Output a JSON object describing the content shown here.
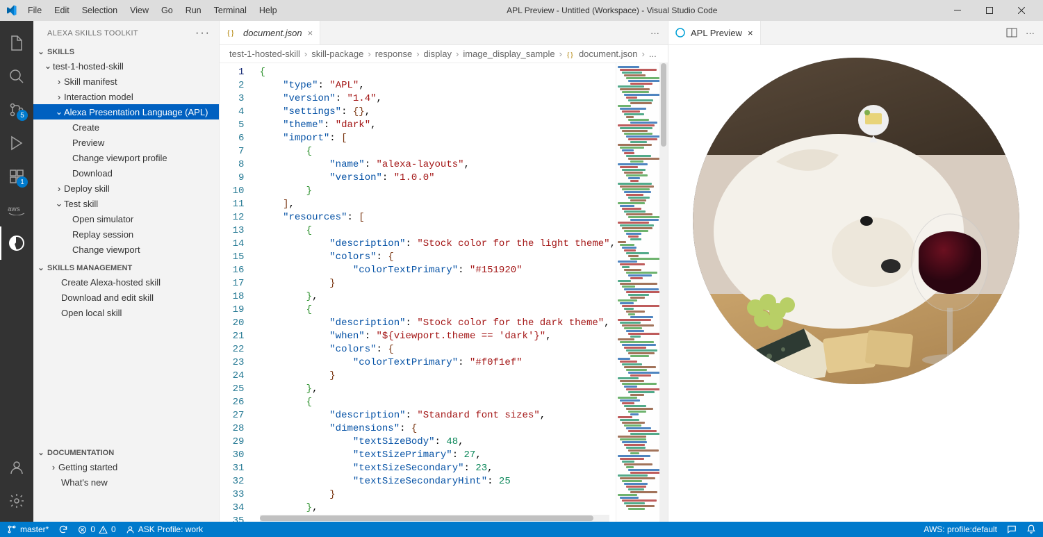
{
  "window": {
    "title": "APL Preview - Untitled (Workspace) - Visual Studio Code",
    "menu": [
      "File",
      "Edit",
      "Selection",
      "View",
      "Go",
      "Run",
      "Terminal",
      "Help"
    ]
  },
  "activity": {
    "scm_badge": "5",
    "ext_badge": "1"
  },
  "sidebar": {
    "title": "ALEXA SKILLS TOOLKIT",
    "sections": {
      "skills": {
        "label": "SKILLS",
        "skill_name": "test-1-hosted-skill",
        "items": {
          "manifest": "Skill manifest",
          "interaction": "Interaction model",
          "apl": "Alexa Presentation Language (APL)",
          "create": "Create",
          "preview": "Preview",
          "change_viewport_profile": "Change viewport profile",
          "download": "Download",
          "deploy": "Deploy skill",
          "test": "Test skill",
          "open_sim": "Open simulator",
          "replay": "Replay session",
          "change_viewport": "Change viewport"
        }
      },
      "management": {
        "label": "SKILLS MANAGEMENT",
        "items": {
          "create_hosted": "Create Alexa-hosted skill",
          "download_edit": "Download and edit skill",
          "open_local": "Open local skill"
        }
      },
      "documentation": {
        "label": "DOCUMENTATION",
        "items": {
          "getting_started": "Getting started",
          "whats_new": "What's new"
        }
      }
    }
  },
  "editor": {
    "tab_label": "document.json",
    "breadcrumbs": [
      "test-1-hosted-skill",
      "skill-package",
      "response",
      "display",
      "image_display_sample",
      "document.json",
      "..."
    ],
    "line_count": 35,
    "code": {
      "type_key": "\"type\"",
      "type_val": "\"APL\"",
      "version_key": "\"version\"",
      "version_val": "\"1.4\"",
      "settings_key": "\"settings\"",
      "theme_key": "\"theme\"",
      "theme_val": "\"dark\"",
      "import_key": "\"import\"",
      "name_key": "\"name\"",
      "name_val": "\"alexa-layouts\"",
      "iversion_val": "\"1.0.0\"",
      "resources_key": "\"resources\"",
      "desc_key": "\"description\"",
      "desc_light": "\"Stock color for the light theme\"",
      "colors_key": "\"colors\"",
      "ctprim_key": "\"colorTextPrimary\"",
      "ctprim_light": "\"#151920\"",
      "desc_dark": "\"Stock color for the dark theme\"",
      "when_key": "\"when\"",
      "when_val": "\"${viewport.theme == 'dark'}\"",
      "ctprim_dark": "\"#f0f1ef\"",
      "desc_fonts": "\"Standard font sizes\"",
      "dim_key": "\"dimensions\"",
      "tsb_key": "\"textSizeBody\"",
      "tsb_val": "48",
      "tsp_key": "\"textSizePrimary\"",
      "tsp_val": "27",
      "tss_key": "\"textSizeSecondary\"",
      "tss_val": "23",
      "tssh_key": "\"textSizeSecondaryHint\"",
      "tssh_val": "25"
    }
  },
  "preview": {
    "tab_label": "APL Preview"
  },
  "status": {
    "branch": "master*",
    "errors": "0",
    "warnings": "0",
    "ask_profile": "ASK Profile: work",
    "aws_profile": "AWS: profile:default"
  }
}
